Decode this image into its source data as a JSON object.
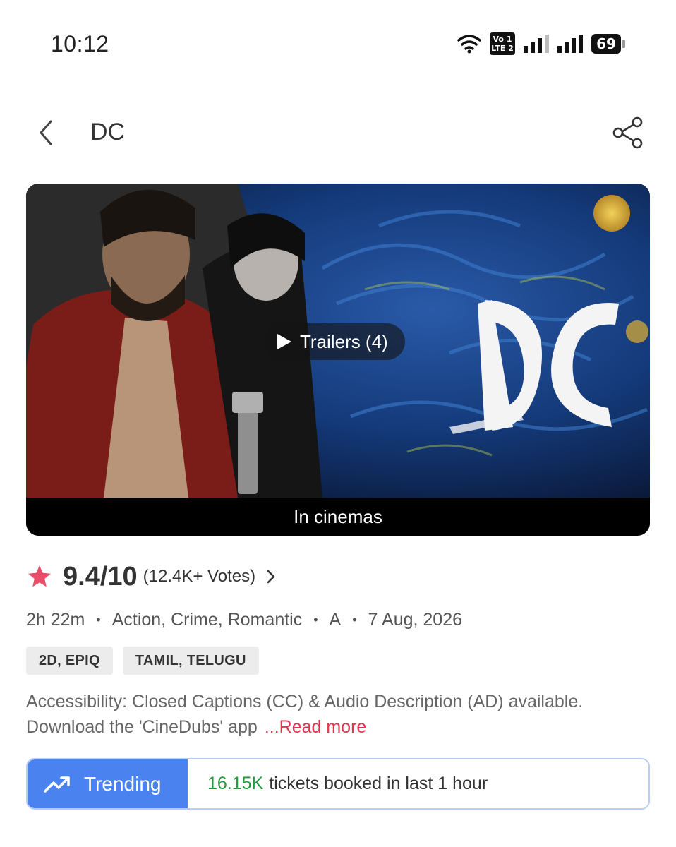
{
  "status_bar": {
    "time": "10:12",
    "volte_top": "Vo 1",
    "volte_bottom": "LTE 2",
    "battery": "69"
  },
  "header": {
    "title": "DC",
    "back_icon": "chevron-left-icon",
    "share_icon": "share-icon"
  },
  "poster": {
    "trailers_label": "Trailers (4)",
    "status_label": "In cinemas",
    "logo_text": "DC"
  },
  "rating": {
    "score": "9.4/10",
    "votes": "(12.4K+ Votes)",
    "star_color": "#e94d6a"
  },
  "meta": {
    "duration": "2h 22m",
    "genres": "Action, Crime, Romantic",
    "certificate": "A",
    "release_date": "7 Aug, 2026",
    "separator": "•"
  },
  "tags": [
    {
      "label": "2D, EPIQ"
    },
    {
      "label": "TAMIL, TELUGU"
    }
  ],
  "description": {
    "line1": "Accessibility: Closed Captions (CC) & Audio Description (AD) available.",
    "line2": "Download the 'CineDubs' app",
    "read_more": "...Read more"
  },
  "trending": {
    "label": "Trending",
    "count": "16.15K",
    "text": "tickets booked in last 1 hour",
    "accent": "#4a82f0",
    "count_color": "#1e9a3c"
  }
}
